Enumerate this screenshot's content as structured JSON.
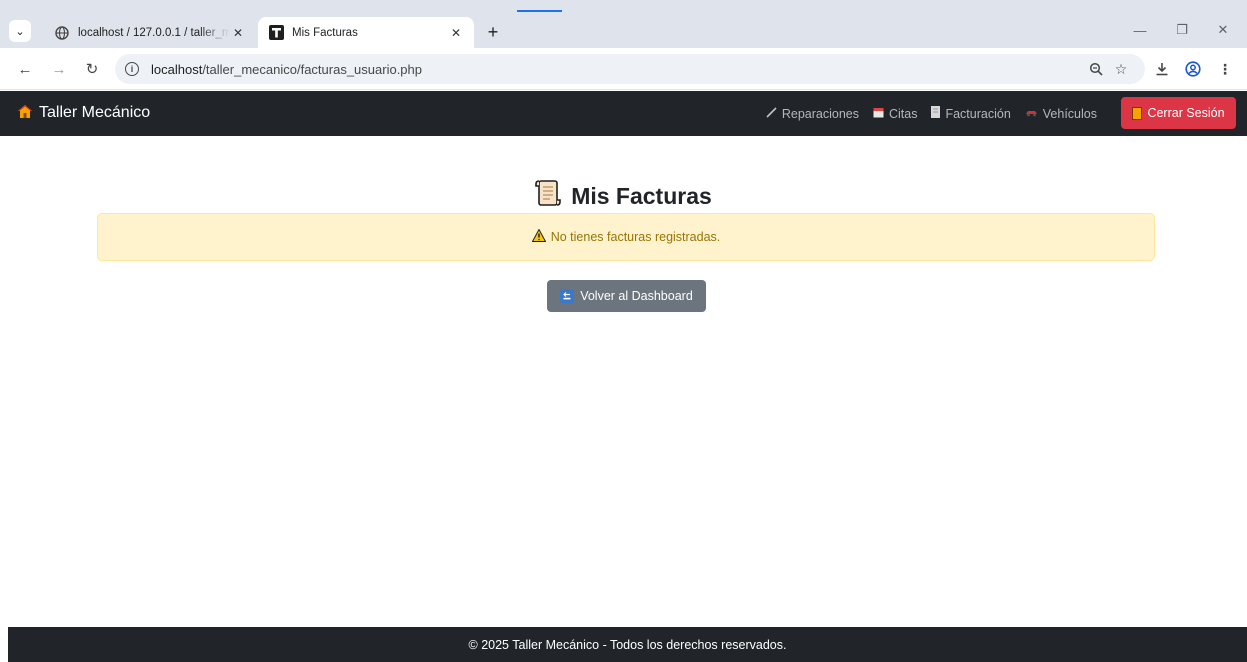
{
  "browser": {
    "tabs": [
      {
        "title": "localhost / 127.0.0.1 / taller_mecanico",
        "favicon": "globe-icon",
        "active": false
      },
      {
        "title": "Mis Facturas",
        "favicon": "t-logo-icon",
        "active": true
      }
    ],
    "url_host": "localhost",
    "url_path": "/taller_mecanico/facturas_usuario.php"
  },
  "navbar": {
    "brand": "Taller Mecánico",
    "brand_icon": "house-icon",
    "links": [
      {
        "label": "Reparaciones",
        "icon": "wrench-icon"
      },
      {
        "label": "Citas",
        "icon": "calendar-icon"
      },
      {
        "label": "Facturación",
        "icon": "receipt-icon"
      },
      {
        "label": "Vehículos",
        "icon": "car-icon"
      }
    ],
    "logout_label": "Cerrar Sesión",
    "logout_color": "#dc3545"
  },
  "main": {
    "title": "Mis Facturas",
    "alert_text": "No tienes facturas registradas.",
    "back_button_label": "Volver al Dashboard"
  },
  "footer": {
    "text": "© 2025 Taller Mecánico - Todos los derechos reservados."
  },
  "colors": {
    "navbar_bg": "#212529",
    "alert_bg": "#fff3cd",
    "secondary_btn": "#6c757d"
  }
}
